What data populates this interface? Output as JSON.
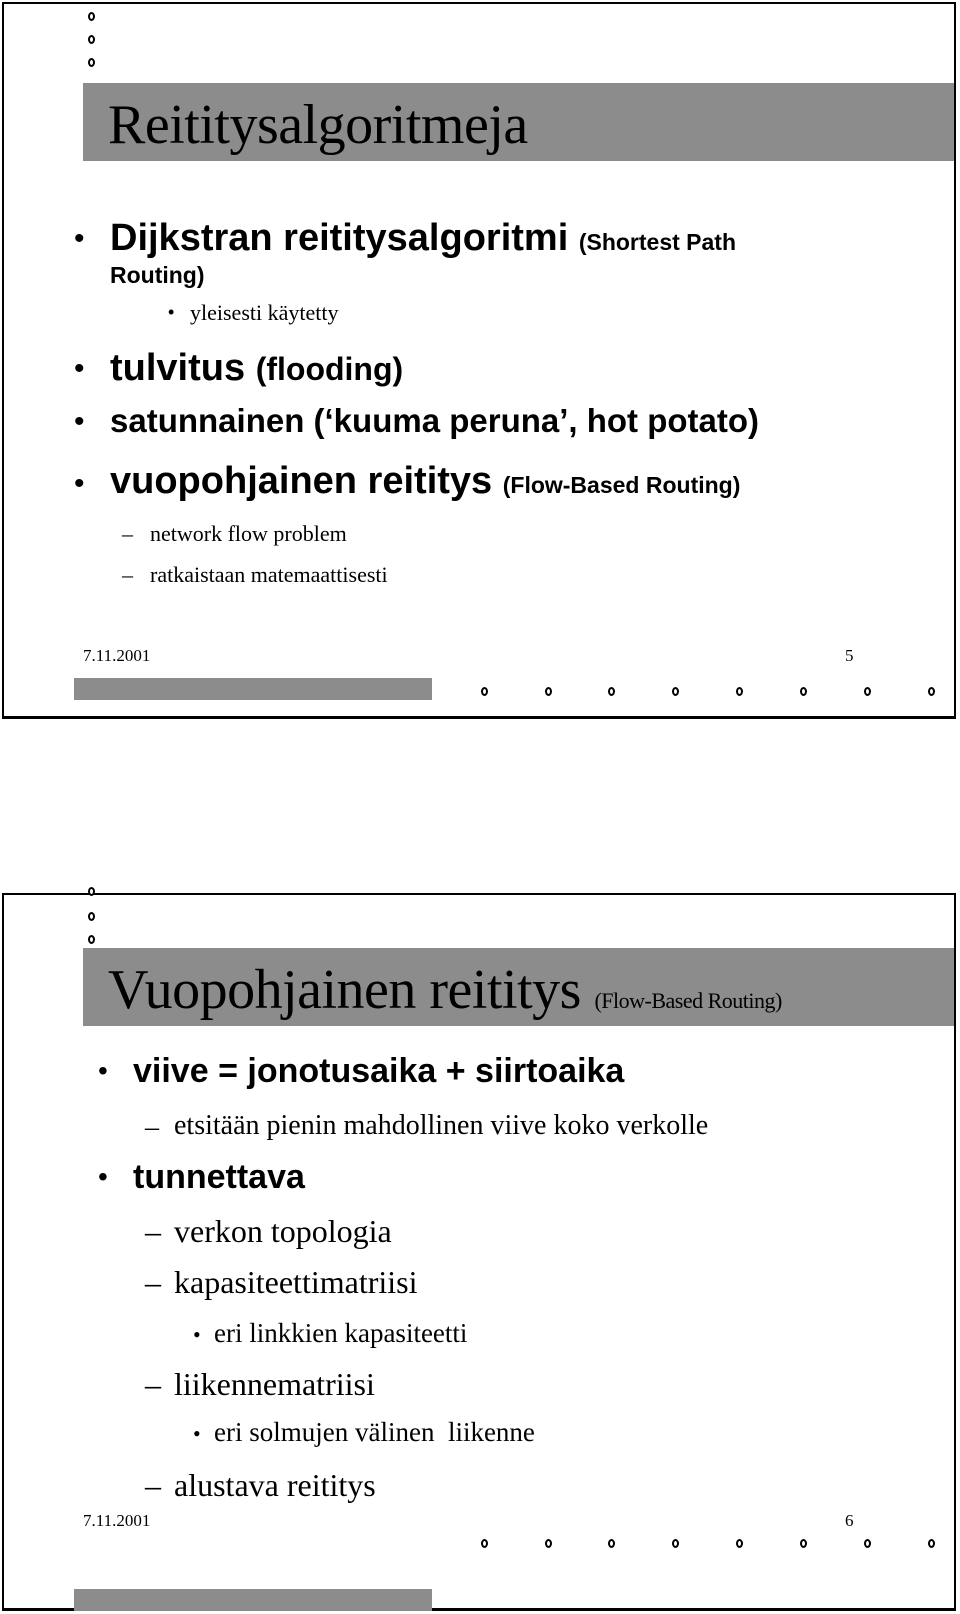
{
  "slides": [
    {
      "title": "Reititysalgoritmeja",
      "items": [
        {
          "level": 1,
          "text": "Dijkstran reititysalgoritmi",
          "aside": "(Shortest Path",
          "aside_cont": "Routing)"
        },
        {
          "level": 2,
          "text": "yleisesti käytetty"
        },
        {
          "level": 1,
          "text": "tulvitus",
          "aside": "(flooding)"
        },
        {
          "level": 1,
          "text": "satunnainen (‘kuuma peruna’, hot potato)"
        },
        {
          "level": 1,
          "text": "vuopohjainen reititys",
          "aside": "(Flow-Based Routing)"
        },
        {
          "level": 2,
          "text": "network flow problem"
        },
        {
          "level": 2,
          "text": "ratkaistaan matemaattisesti"
        }
      ],
      "footer": {
        "date": "7.11.2001",
        "page": "5"
      }
    },
    {
      "title": "Vuopohjainen reititys",
      "title_sub": "(Flow-Based Routing)",
      "items": [
        {
          "level": 1,
          "text": "viive = jonotusaika + siirtoaika"
        },
        {
          "level": 2,
          "text": "etsitään pienin mahdollinen viive koko verkolle"
        },
        {
          "level": 1,
          "text": "tunnettava"
        },
        {
          "level": 2,
          "text": "verkon topologia"
        },
        {
          "level": 2,
          "text": "kapasiteettimatriisi"
        },
        {
          "level": 3,
          "text": "eri linkkien kapasiteetti"
        },
        {
          "level": 2,
          "text": "liikennematriisi"
        },
        {
          "level": 3,
          "text": "eri solmujen välinen  liikenne"
        },
        {
          "level": 2,
          "text": "alustava reititys"
        }
      ],
      "footer": {
        "date": "7.11.2001",
        "page": "6"
      }
    }
  ],
  "symbols": {
    "bullet": "•",
    "dash": "–"
  },
  "colors": {
    "title_band": "#8c8c8c",
    "text": "#000000",
    "border": "#000000"
  }
}
